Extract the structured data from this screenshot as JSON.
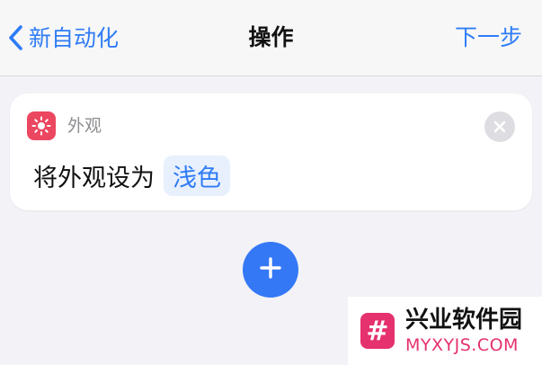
{
  "nav": {
    "back_label": "新自动化",
    "title": "操作",
    "next_label": "下一步"
  },
  "action_card": {
    "app_icon": "sun-icon",
    "app_name": "外观",
    "action_text": "将外观设为",
    "parameter_value": "浅色",
    "close_icon": "close-icon"
  },
  "add_button": {
    "icon": "plus-icon"
  },
  "watermark": {
    "logo_glyph": "#",
    "name": "兴业软件园",
    "url": "MYXYJS.COM"
  },
  "colors": {
    "accent": "#2f7cf6",
    "app_icon_bg": "#ec4760",
    "background": "#f2f2f7",
    "watermark_brand": "#e5316e"
  }
}
